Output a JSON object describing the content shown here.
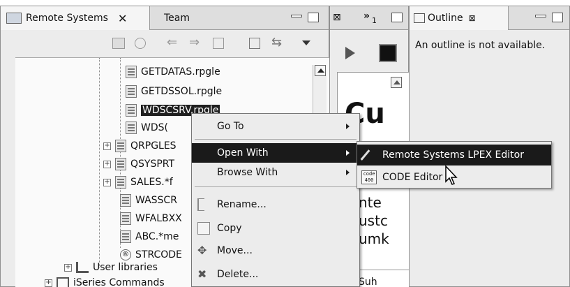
{
  "remote_panel": {
    "tab_active": "Remote Systems",
    "tab_other": "Team"
  },
  "tree": {
    "rows": [
      {
        "label": "GETDATAS.rpgle"
      },
      {
        "label": "GETDSSOL.rpgle"
      },
      {
        "label": "WDSCSRV.rpgle"
      },
      {
        "label": "WDS("
      },
      {
        "label": "QRPGLES"
      },
      {
        "label": "QSYSPRT"
      },
      {
        "label": "SALES.*f"
      },
      {
        "label": "WASSCR"
      },
      {
        "label": "WFALBXX"
      },
      {
        "label": "ABC.*me"
      },
      {
        "label": "STRCODE"
      },
      {
        "label": "User libraries"
      },
      {
        "label": "iSeries Commands"
      }
    ]
  },
  "context_menu": {
    "items": [
      {
        "label": "Go To"
      },
      {
        "label": "Open With"
      },
      {
        "label": "Browse With"
      },
      {
        "label": "Rename..."
      },
      {
        "label": "Copy"
      },
      {
        "label": "Move..."
      },
      {
        "label": "Delete..."
      }
    ]
  },
  "submenu": {
    "items": [
      {
        "label": "Remote Systems LPEX Editor"
      },
      {
        "label": "CODE Editor"
      }
    ],
    "code_icon_top": "code",
    "code_icon_bottom": "400"
  },
  "middle_panel": {
    "tab_number": "1",
    "editor_text_big": "Cu",
    "editor_lines": [
      "nte",
      "ustc",
      "umk"
    ],
    "editor_bottom": "Suh"
  },
  "outline_panel": {
    "title": "Outline",
    "message": "An outline is not available."
  },
  "colors": {
    "selection": "#1a1a1a",
    "panel_bg": "#ececec",
    "tab_bar": "#dedede"
  }
}
